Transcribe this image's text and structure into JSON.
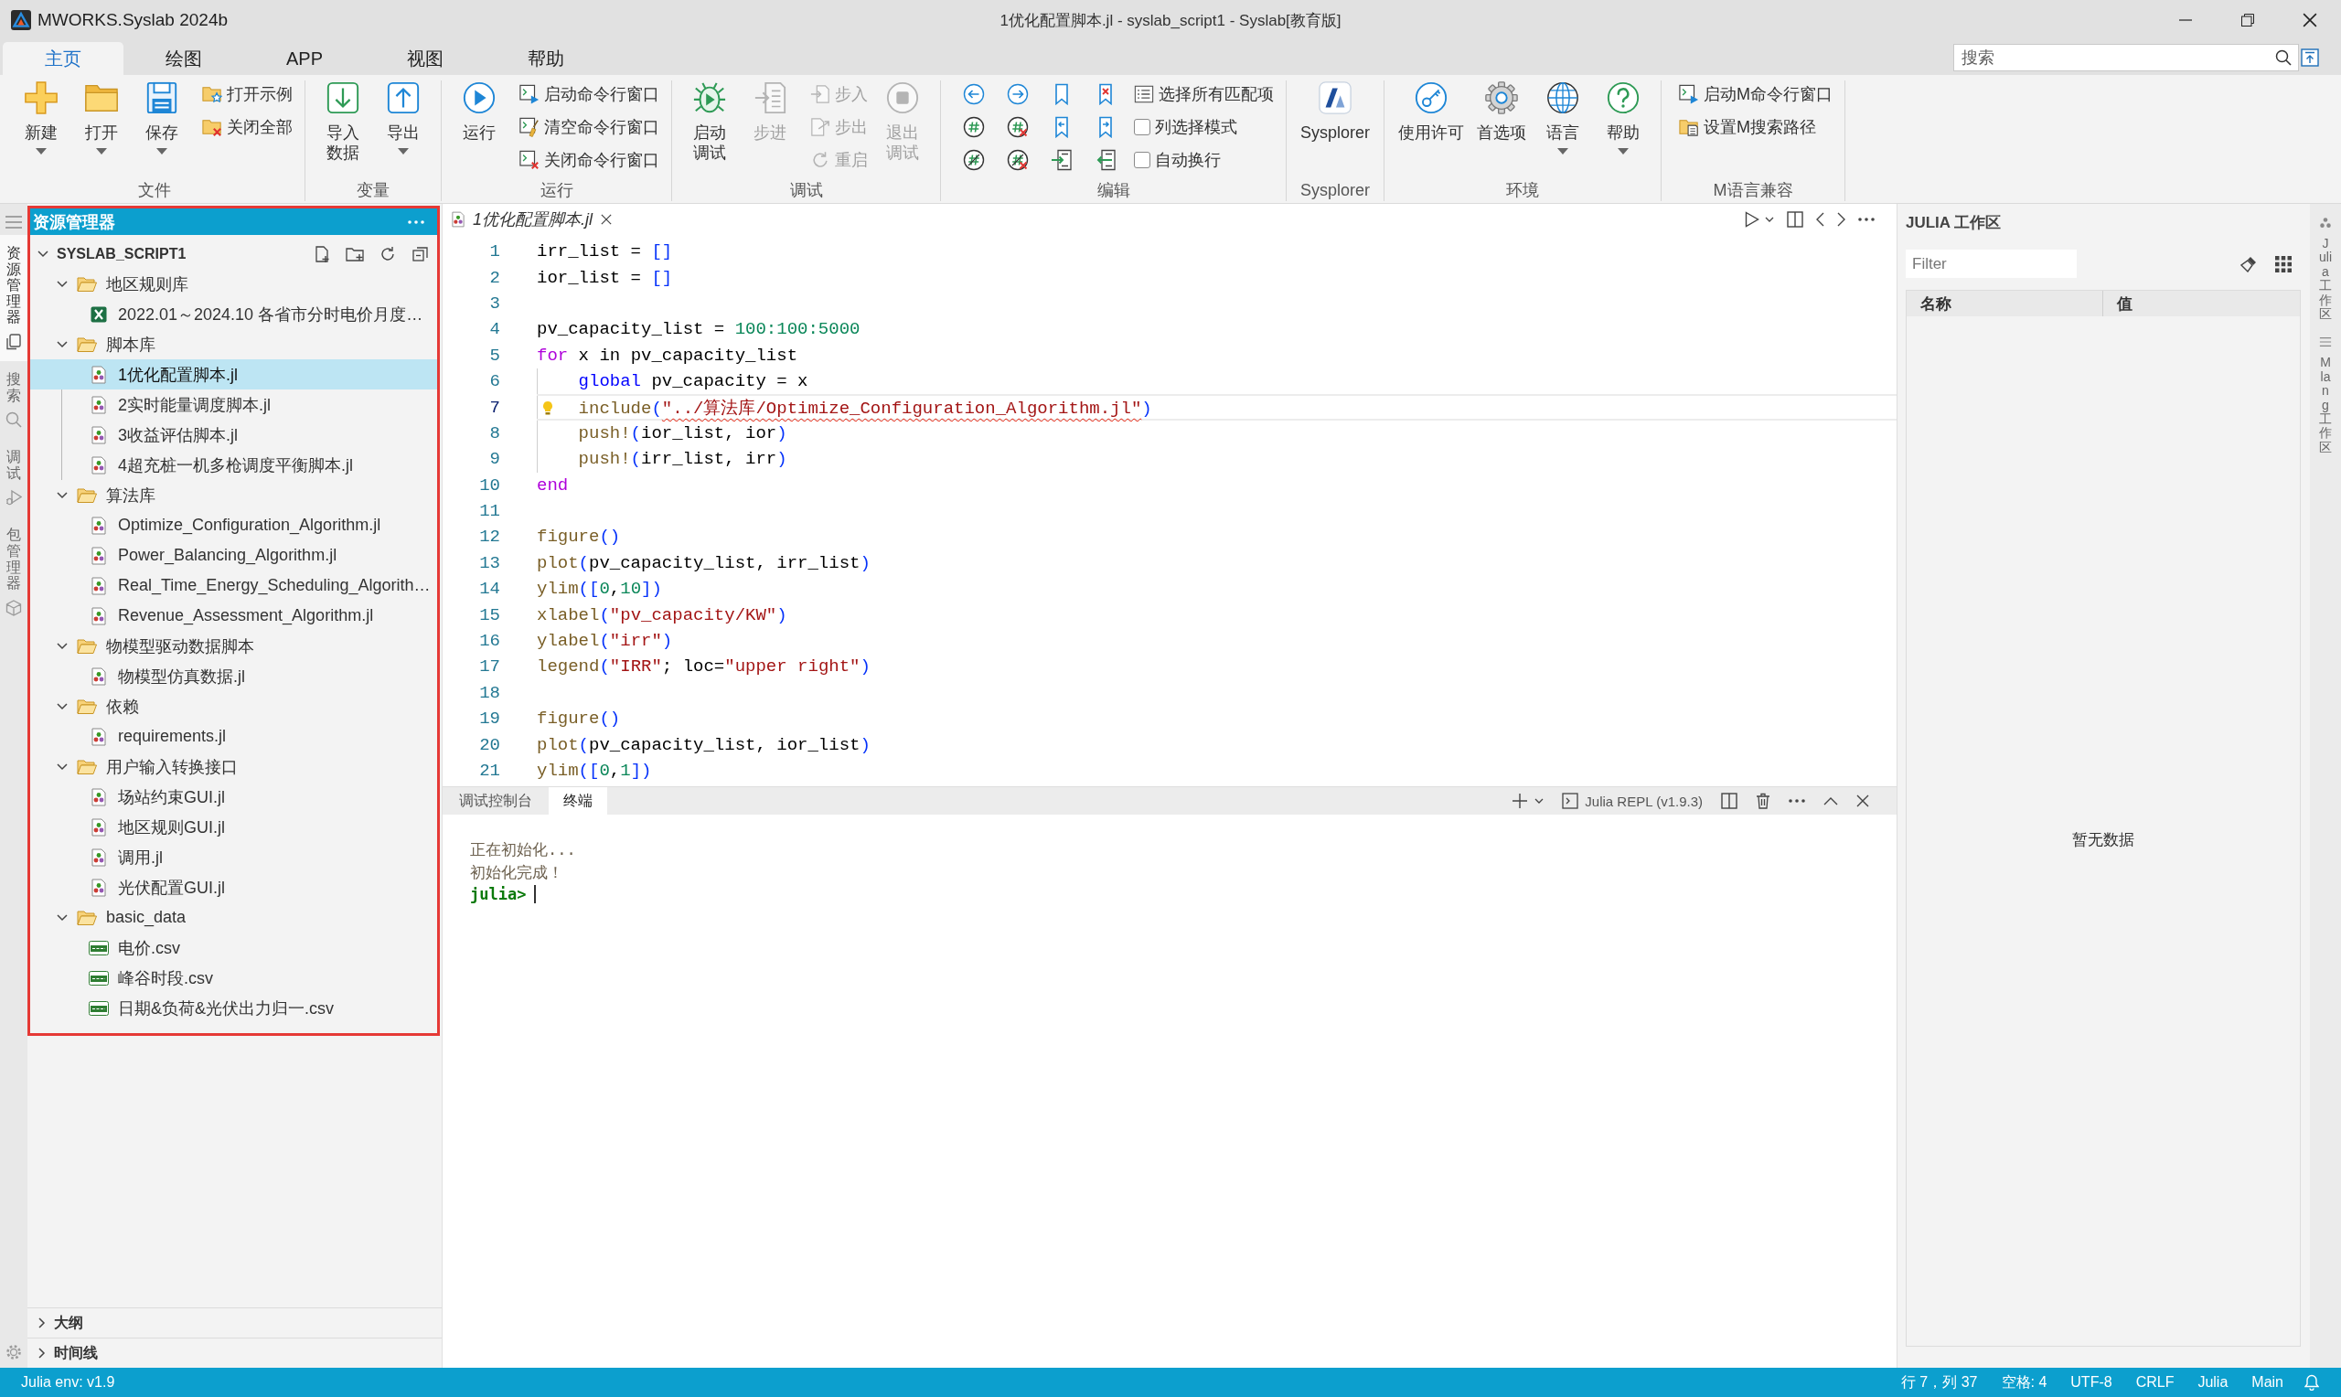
{
  "window": {
    "app_name": "MWORKS.Syslab 2024b",
    "title": "1优化配置脚本.jl - syslab_script1 - Syslab[教育版]"
  },
  "ribbon_tabs": [
    {
      "label": "主页",
      "selected": true
    },
    {
      "label": "绘图",
      "selected": false
    },
    {
      "label": "APP",
      "selected": false
    },
    {
      "label": "视图",
      "selected": false
    },
    {
      "label": "帮助",
      "selected": false
    }
  ],
  "search": {
    "placeholder": "搜索"
  },
  "ribbon_groups": [
    {
      "label": "文件",
      "items": [
        {
          "kind": "large",
          "label_lines": [
            "新建"
          ],
          "dropdown": true,
          "disabled": false
        },
        {
          "kind": "large",
          "label_lines": [
            "打开"
          ],
          "dropdown": true,
          "disabled": false
        },
        {
          "kind": "large",
          "label_lines": [
            "保存"
          ],
          "dropdown": true,
          "disabled": false
        },
        {
          "kind": "small",
          "label": "打开示例",
          "disabled": false
        },
        {
          "kind": "small",
          "label": "关闭全部",
          "disabled": false
        }
      ]
    },
    {
      "label": "变量",
      "items": [
        {
          "kind": "large",
          "label_lines": [
            "导入",
            "数据"
          ],
          "dropdown": false,
          "disabled": false
        },
        {
          "kind": "large",
          "label_lines": [
            "导出"
          ],
          "dropdown": true,
          "disabled": false
        }
      ]
    },
    {
      "label": "运行",
      "items": [
        {
          "kind": "large",
          "label_lines": [
            "运行"
          ],
          "dropdown": false,
          "disabled": false
        },
        {
          "kind": "small",
          "label": "启动命令行窗口",
          "disabled": false
        },
        {
          "kind": "small",
          "label": "清空命令行窗口",
          "disabled": false
        },
        {
          "kind": "small",
          "label": "关闭命令行窗口",
          "disabled": false
        }
      ]
    },
    {
      "label": "调试",
      "items": [
        {
          "kind": "large",
          "label_lines": [
            "启动",
            "调试"
          ],
          "dropdown": false,
          "disabled": false
        },
        {
          "kind": "large",
          "label_lines": [
            "步进"
          ],
          "dropdown": false,
          "disabled": true
        },
        {
          "kind": "small",
          "label": "步入",
          "disabled": true
        },
        {
          "kind": "small",
          "label": "步出",
          "disabled": true
        },
        {
          "kind": "small",
          "label": "重启",
          "disabled": true
        },
        {
          "kind": "large",
          "label_lines": [
            "退出",
            "调试"
          ],
          "dropdown": false,
          "disabled": true
        }
      ]
    },
    {
      "label": "编辑",
      "items": [
        {
          "kind": "icon",
          "disabled": false
        },
        {
          "kind": "icon",
          "disabled": false
        },
        {
          "kind": "icon",
          "disabled": false
        },
        {
          "kind": "icon",
          "disabled": false
        },
        {
          "kind": "icon",
          "disabled": false
        },
        {
          "kind": "icon",
          "disabled": false
        },
        {
          "kind": "icon",
          "disabled": false
        },
        {
          "kind": "icon",
          "disabled": false
        },
        {
          "kind": "icon",
          "disabled": false
        },
        {
          "kind": "icon",
          "disabled": false
        },
        {
          "kind": "icon",
          "disabled": false
        },
        {
          "kind": "icon",
          "disabled": false
        },
        {
          "kind": "small",
          "label": "选择所有匹配项",
          "disabled": false
        },
        {
          "kind": "check",
          "label": "列选择模式",
          "checked": false,
          "disabled": false
        },
        {
          "kind": "check",
          "label": "自动换行",
          "checked": false,
          "disabled": false
        }
      ]
    },
    {
      "label": "Sysplorer",
      "items": [
        {
          "kind": "large",
          "label_lines": [
            "Sysplorer"
          ],
          "dropdown": false,
          "disabled": false
        }
      ]
    },
    {
      "label": "环境",
      "items": [
        {
          "kind": "large",
          "label_lines": [
            "使用许可"
          ],
          "dropdown": false,
          "disabled": false
        },
        {
          "kind": "large",
          "label_lines": [
            "首选项"
          ],
          "dropdown": false,
          "disabled": false
        },
        {
          "kind": "large",
          "label_lines": [
            "语言"
          ],
          "dropdown": true,
          "disabled": false
        },
        {
          "kind": "large",
          "label_lines": [
            "帮助"
          ],
          "dropdown": true,
          "disabled": false
        }
      ]
    },
    {
      "label": "M语言兼容",
      "items": [
        {
          "kind": "small",
          "label": "启动M命令行窗口",
          "disabled": false
        },
        {
          "kind": "small",
          "label": "设置M搜索路径",
          "disabled": false
        }
      ]
    }
  ],
  "activity_bar": [
    {
      "label": "资源管理器",
      "selected": true
    },
    {
      "label": "搜索",
      "selected": false
    },
    {
      "label": "调试",
      "selected": false
    },
    {
      "label": "包管理器",
      "selected": false
    }
  ],
  "explorer": {
    "title": "资源管理器",
    "root": {
      "label": "SYSLAB_SCRIPT1",
      "expanded": true
    },
    "tree": [
      {
        "kind": "folder",
        "label": "地区规则库",
        "expanded": true,
        "selected": false,
        "children": [
          {
            "kind": "excel",
            "label": "2022.01～2024.10 各省市分时电价月度…",
            "selected": false
          }
        ]
      },
      {
        "kind": "folder",
        "label": "脚本库",
        "expanded": true,
        "selected": false,
        "children": [
          {
            "kind": "julia",
            "label": "1优化配置脚本.jl",
            "selected": true
          },
          {
            "kind": "julia",
            "label": "2实时能量调度脚本.jl",
            "selected": false
          },
          {
            "kind": "julia",
            "label": "3收益评估脚本.jl",
            "selected": false
          },
          {
            "kind": "julia",
            "label": "4超充桩一机多枪调度平衡脚本.jl",
            "selected": false
          }
        ]
      },
      {
        "kind": "folder",
        "label": "算法库",
        "expanded": true,
        "selected": false,
        "children": [
          {
            "kind": "julia",
            "label": "Optimize_Configuration_Algorithm.jl",
            "selected": false
          },
          {
            "kind": "julia",
            "label": "Power_Balancing_Algorithm.jl",
            "selected": false
          },
          {
            "kind": "julia",
            "label": "Real_Time_Energy_Scheduling_Algorith…",
            "selected": false
          },
          {
            "kind": "julia",
            "label": "Revenue_Assessment_Algorithm.jl",
            "selected": false
          }
        ]
      },
      {
        "kind": "folder",
        "label": "物模型驱动数据脚本",
        "expanded": true,
        "selected": false,
        "children": [
          {
            "kind": "julia",
            "label": "物模型仿真数据.jl",
            "selected": false
          }
        ]
      },
      {
        "kind": "folder",
        "label": "依赖",
        "expanded": true,
        "selected": false,
        "children": [
          {
            "kind": "julia",
            "label": "requirements.jl",
            "selected": false
          }
        ]
      },
      {
        "kind": "folder",
        "label": "用户输入转换接口",
        "expanded": true,
        "selected": false,
        "children": [
          {
            "kind": "julia",
            "label": "场站约束GUI.jl",
            "selected": false
          },
          {
            "kind": "julia",
            "label": "地区规则GUI.jl",
            "selected": false
          },
          {
            "kind": "julia",
            "label": "调用.jl",
            "selected": false
          },
          {
            "kind": "julia",
            "label": "光伏配置GUI.jl",
            "selected": false
          }
        ]
      },
      {
        "kind": "folder",
        "label": "basic_data",
        "expanded": true,
        "selected": false,
        "children": [
          {
            "kind": "csv",
            "label": "电价.csv",
            "selected": false
          },
          {
            "kind": "csv",
            "label": "峰谷时段.csv",
            "selected": false
          },
          {
            "kind": "csv",
            "label": "日期&负荷&光伏出力归一.csv",
            "selected": false
          }
        ]
      }
    ]
  },
  "sidebar_sections": [
    {
      "label": "大纲",
      "expanded": false
    },
    {
      "label": "时间线",
      "expanded": false
    }
  ],
  "editor": {
    "tabs": [
      {
        "label": "1优化配置脚本.jl",
        "selected": true,
        "preview": true
      }
    ],
    "lines": [
      {
        "number": "1",
        "current": false,
        "lightbulb": false,
        "indented": false,
        "tokens": [
          {
            "kind": "plain",
            "text": "irr_list = "
          },
          {
            "kind": "bracket",
            "text": "[]"
          }
        ]
      },
      {
        "number": "2",
        "current": false,
        "lightbulb": false,
        "indented": false,
        "tokens": [
          {
            "kind": "plain",
            "text": "ior_list = "
          },
          {
            "kind": "bracket",
            "text": "[]"
          }
        ]
      },
      {
        "number": "3",
        "current": false,
        "lightbulb": false,
        "indented": false
      },
      {
        "number": "4",
        "current": false,
        "lightbulb": false,
        "indented": false,
        "tokens": [
          {
            "kind": "plain",
            "text": "pv_capacity_list = "
          },
          {
            "kind": "number",
            "text": "100:100:5000"
          }
        ]
      },
      {
        "number": "5",
        "current": false,
        "lightbulb": false,
        "indented": false,
        "tokens": [
          {
            "kind": "keyword",
            "text": "for"
          },
          {
            "kind": "plain",
            "text": " x in pv_capacity_list"
          }
        ]
      },
      {
        "number": "6",
        "current": false,
        "lightbulb": false,
        "indented": true,
        "tokens": [
          {
            "kind": "control",
            "text": "global"
          },
          {
            "kind": "plain",
            "text": " pv_capacity = x"
          }
        ]
      },
      {
        "number": "7",
        "current": true,
        "lightbulb": true,
        "indented": true,
        "tokens": [
          {
            "kind": "function",
            "text": "include"
          },
          {
            "kind": "bracket",
            "text": "("
          },
          {
            "kind": "string_error",
            "text": "\"../算法库/Optimize_Configuration_Algorithm.jl\""
          },
          {
            "kind": "bracket",
            "text": ")"
          }
        ]
      },
      {
        "number": "8",
        "current": false,
        "lightbulb": false,
        "indented": true,
        "tokens": [
          {
            "kind": "function",
            "text": "push!"
          },
          {
            "kind": "bracket",
            "text": "("
          },
          {
            "kind": "plain",
            "text": "ior_list, ior"
          },
          {
            "kind": "bracket",
            "text": ")"
          }
        ]
      },
      {
        "number": "9",
        "current": false,
        "lightbulb": false,
        "indented": true,
        "tokens": [
          {
            "kind": "function",
            "text": "push!"
          },
          {
            "kind": "bracket",
            "text": "("
          },
          {
            "kind": "plain",
            "text": "irr_list, irr"
          },
          {
            "kind": "bracket",
            "text": ")"
          }
        ]
      },
      {
        "number": "10",
        "current": false,
        "lightbulb": false,
        "indented": false,
        "tokens": [
          {
            "kind": "keyword",
            "text": "end"
          }
        ]
      },
      {
        "number": "11",
        "current": false,
        "lightbulb": false,
        "indented": false
      },
      {
        "number": "12",
        "current": false,
        "lightbulb": false,
        "indented": false,
        "tokens": [
          {
            "kind": "function",
            "text": "figure"
          },
          {
            "kind": "bracket",
            "text": "()"
          }
        ]
      },
      {
        "number": "13",
        "current": false,
        "lightbulb": false,
        "indented": false,
        "tokens": [
          {
            "kind": "function",
            "text": "plot"
          },
          {
            "kind": "bracket",
            "text": "("
          },
          {
            "kind": "plain",
            "text": "pv_capacity_list, irr_list"
          },
          {
            "kind": "bracket",
            "text": ")"
          }
        ]
      },
      {
        "number": "14",
        "current": false,
        "lightbulb": false,
        "indented": false,
        "tokens": [
          {
            "kind": "function",
            "text": "ylim"
          },
          {
            "kind": "bracket",
            "text": "(["
          },
          {
            "kind": "number",
            "text": "0"
          },
          {
            "kind": "plain",
            "text": ","
          },
          {
            "kind": "number",
            "text": "10"
          },
          {
            "kind": "bracket",
            "text": "])"
          }
        ]
      },
      {
        "number": "15",
        "current": false,
        "lightbulb": false,
        "indented": false,
        "tokens": [
          {
            "kind": "function",
            "text": "xlabel"
          },
          {
            "kind": "bracket",
            "text": "("
          },
          {
            "kind": "string",
            "text": "\"pv_capacity/KW\""
          },
          {
            "kind": "bracket",
            "text": ")"
          }
        ]
      },
      {
        "number": "16",
        "current": false,
        "lightbulb": false,
        "indented": false,
        "tokens": [
          {
            "kind": "function",
            "text": "ylabel"
          },
          {
            "kind": "bracket",
            "text": "("
          },
          {
            "kind": "string",
            "text": "\"irr\""
          },
          {
            "kind": "bracket",
            "text": ")"
          }
        ]
      },
      {
        "number": "17",
        "current": false,
        "lightbulb": false,
        "indented": false,
        "tokens": [
          {
            "kind": "function",
            "text": "legend"
          },
          {
            "kind": "bracket",
            "text": "("
          },
          {
            "kind": "string",
            "text": "\"IRR\""
          },
          {
            "kind": "plain",
            "text": "; loc="
          },
          {
            "kind": "string",
            "text": "\"upper right\""
          },
          {
            "kind": "bracket",
            "text": ")"
          }
        ]
      },
      {
        "number": "18",
        "current": false,
        "lightbulb": false,
        "indented": false
      },
      {
        "number": "19",
        "current": false,
        "lightbulb": false,
        "indented": false,
        "tokens": [
          {
            "kind": "function",
            "text": "figure"
          },
          {
            "kind": "bracket",
            "text": "()"
          }
        ]
      },
      {
        "number": "20",
        "current": false,
        "lightbulb": false,
        "indented": false,
        "tokens": [
          {
            "kind": "function",
            "text": "plot"
          },
          {
            "kind": "bracket",
            "text": "("
          },
          {
            "kind": "plain",
            "text": "pv_capacity_list, ior_list"
          },
          {
            "kind": "bracket",
            "text": ")"
          }
        ]
      },
      {
        "number": "21",
        "current": false,
        "lightbulb": false,
        "indented": false,
        "tokens": [
          {
            "kind": "function",
            "text": "ylim"
          },
          {
            "kind": "bracket",
            "text": "(["
          },
          {
            "kind": "number",
            "text": "0"
          },
          {
            "kind": "plain",
            "text": ","
          },
          {
            "kind": "number",
            "text": "1"
          },
          {
            "kind": "bracket",
            "text": "])"
          }
        ]
      }
    ]
  },
  "panel": {
    "tabs": [
      {
        "label": "调试控制台",
        "selected": false
      },
      {
        "label": "终端",
        "selected": true
      }
    ],
    "terminal_label": "Julia REPL (v1.9.3)",
    "lines": [
      {
        "kind": "output",
        "text": "正在初始化..."
      },
      {
        "kind": "output",
        "text": "初始化完成！"
      },
      {
        "kind": "prompt",
        "text": "julia>"
      }
    ]
  },
  "workspace": {
    "title": "JULIA 工作区",
    "filter": {
      "placeholder": "Filter"
    },
    "columns": [
      "名称",
      "值"
    ],
    "empty": "暂无数据"
  },
  "right_bar": [
    {
      "label": "Julia 工作区"
    },
    {
      "label": "Mlang 工作区"
    }
  ],
  "status_bar": {
    "left": [
      "Julia env: v1.9"
    ],
    "right": [
      "行 7，列 37",
      "空格: 4",
      "UTF-8",
      "CRLF",
      "Julia",
      "Main"
    ]
  }
}
